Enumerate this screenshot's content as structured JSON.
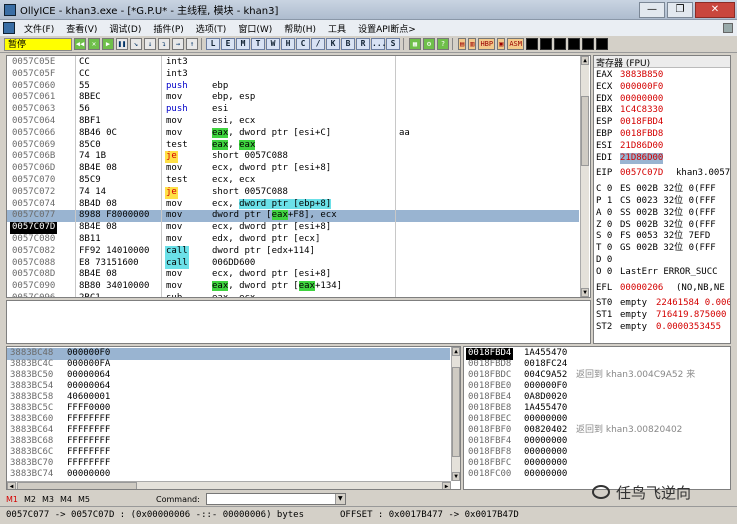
{
  "window": {
    "title": "OllyICE - khan3.exe - [*G.P.U* - 主线程, 模块 - khan3]",
    "min": "—",
    "max": "❐",
    "close": "✕"
  },
  "menu": [
    "文件(F)",
    "查看(V)",
    "调试(D)",
    "插件(P)",
    "选项(T)",
    "窗口(W)",
    "帮助(H)",
    "工具",
    "设置API断点>"
  ],
  "toolbar": {
    "status": "暂停",
    "buttons_a": [
      "◀◀",
      "✕",
      "▶",
      "❚❚",
      "↘",
      "↓",
      "↴",
      "→",
      "↑"
    ],
    "letters": [
      "L",
      "E",
      "M",
      "T",
      "W",
      "H",
      "C",
      "/",
      "K",
      "B",
      "R",
      "...",
      "S"
    ],
    "buttons_b": [
      "▦",
      "⚙",
      "?"
    ],
    "buttons_c": [
      "▤",
      "▥",
      "HBP",
      "▣",
      "ASM"
    ]
  },
  "disasm": {
    "rows": [
      {
        "addr": "0057C05E",
        "hex": "CC",
        "mn": "int3",
        "op": "",
        "cm": "",
        "mnstyle": "",
        "opparts": []
      },
      {
        "addr": "0057C05F",
        "hex": "CC",
        "mn": "int3",
        "op": "",
        "cm": "",
        "mnstyle": "",
        "opparts": []
      },
      {
        "addr": "0057C060",
        "hex": "55",
        "mn": "push",
        "op": "ebp",
        "cm": "",
        "mnstyle": "kw",
        "opparts": []
      },
      {
        "addr": "0057C061",
        "hex": "8BEC",
        "mn": "mov",
        "op": "ebp, esp",
        "cm": "",
        "mnstyle": "",
        "opparts": []
      },
      {
        "addr": "0057C063",
        "hex": "56",
        "mn": "push",
        "op": "esi",
        "cm": "",
        "mnstyle": "kw",
        "opparts": []
      },
      {
        "addr": "0057C064",
        "hex": "8BF1",
        "mn": "mov",
        "op": "esi, ecx",
        "cm": "",
        "mnstyle": "",
        "opparts": []
      },
      {
        "addr": "0057C066",
        "hex": "8B46 0C",
        "mn": "mov",
        "op": "",
        "cm": "aa",
        "mnstyle": "",
        "opparts": [
          {
            "t": "eax",
            "s": "hl-green"
          },
          {
            "t": ", dword ptr [esi+C]",
            "s": ""
          }
        ]
      },
      {
        "addr": "0057C069",
        "hex": "85C0",
        "mn": "test",
        "op": "",
        "cm": "",
        "mnstyle": "",
        "opparts": [
          {
            "t": "eax",
            "s": "hl-green"
          },
          {
            "t": ", ",
            "s": ""
          },
          {
            "t": "eax",
            "s": "hl-green"
          }
        ]
      },
      {
        "addr": "0057C06B",
        "hex": "74 1B",
        "mn": "je",
        "op": "short 0057C088",
        "cm": "",
        "mnstyle": "hl-yellow red",
        "opparts": []
      },
      {
        "addr": "0057C06D",
        "hex": "8B4E 08",
        "mn": "mov",
        "op": "ecx, dword ptr [esi+8]",
        "cm": "",
        "mnstyle": "",
        "opparts": []
      },
      {
        "addr": "0057C070",
        "hex": "85C9",
        "mn": "test",
        "op": "ecx, ecx",
        "cm": "",
        "mnstyle": "",
        "opparts": []
      },
      {
        "addr": "0057C072",
        "hex": "74 14",
        "mn": "je",
        "op": "short 0057C088",
        "cm": "",
        "mnstyle": "hl-yellow red",
        "opparts": []
      },
      {
        "addr": "0057C074",
        "hex": "8B4D 08",
        "mn": "mov",
        "op": "",
        "cm": "",
        "mnstyle": "",
        "opparts": [
          {
            "t": "ecx, ",
            "s": ""
          },
          {
            "t": "dword ptr [ebp+8]",
            "s": "hl-cyan"
          }
        ]
      },
      {
        "addr": "0057C077",
        "hex": "8988 F8000000",
        "mn": "mov",
        "op": "",
        "cm": "",
        "mnstyle": "",
        "opparts": [
          {
            "t": "dword ptr [",
            "s": ""
          },
          {
            "t": "eax",
            "s": "hl-green"
          },
          {
            "t": "+F8], ecx",
            "s": ""
          }
        ]
      },
      {
        "addr": "0057C07D",
        "hex": "8B4E 08",
        "mn": "mov",
        "op": "ecx, dword ptr [esi+8]",
        "cm": "",
        "mnstyle": "",
        "opparts": []
      },
      {
        "addr": "0057C080",
        "hex": "8B11",
        "mn": "mov",
        "op": "edx, dword ptr [ecx]",
        "cm": "",
        "mnstyle": "",
        "opparts": []
      },
      {
        "addr": "0057C082",
        "hex": "FF92 14010000",
        "mn": "call",
        "op": "dword ptr [edx+114]",
        "cm": "",
        "mnstyle": "hl-cyan",
        "opparts": []
      },
      {
        "addr": "0057C088",
        "hex": "E8 73151600",
        "mn": "call",
        "op": "006DD600",
        "cm": "",
        "mnstyle": "hl-cyan",
        "opparts": []
      },
      {
        "addr": "0057C08D",
        "hex": "8B4E 08",
        "mn": "mov",
        "op": "ecx, dword ptr [esi+8]",
        "cm": "",
        "mnstyle": "",
        "opparts": []
      },
      {
        "addr": "0057C090",
        "hex": "8B80 34010000",
        "mn": "mov",
        "op": "",
        "cm": "",
        "mnstyle": "",
        "opparts": [
          {
            "t": "eax",
            "s": "hl-green"
          },
          {
            "t": ", dword ptr [",
            "s": ""
          },
          {
            "t": "eax",
            "s": "hl-green"
          },
          {
            "t": "+134]",
            "s": ""
          }
        ]
      },
      {
        "addr": "0057C096",
        "hex": "2BC1",
        "mn": "sub",
        "op": "eax, ecx",
        "cm": "",
        "mnstyle": "",
        "opparts": []
      }
    ]
  },
  "registers": {
    "header": "寄存器 (FPU)",
    "regs": [
      {
        "n": "EAX",
        "v": "3883B850",
        "x": ""
      },
      {
        "n": "ECX",
        "v": "000000F0",
        "x": ""
      },
      {
        "n": "EDX",
        "v": "00000000",
        "x": ""
      },
      {
        "n": "EBX",
        "v": "1C4C8330",
        "x": ""
      },
      {
        "n": "ESP",
        "v": "0018FBD4",
        "x": ""
      },
      {
        "n": "EBP",
        "v": "0018FBD8",
        "x": ""
      },
      {
        "n": "ESI",
        "v": "21D86D00",
        "x": ""
      },
      {
        "n": "EDI",
        "v": "21D86D00",
        "x": ""
      }
    ],
    "eip": {
      "n": "EIP",
      "v": "0057C07D",
      "x": "khan3.0057"
    },
    "flags": [
      {
        "f": "C 0",
        "s": "ES 002B 32位 0(FFF"
      },
      {
        "f": "P 1",
        "s": "CS 0023 32位 0(FFF"
      },
      {
        "f": "A 0",
        "s": "SS 002B 32位 0(FFF"
      },
      {
        "f": "Z 0",
        "s": "DS 002B 32位 0(FFF"
      },
      {
        "f": "S 0",
        "s": "FS 0053 32位 7EFD"
      },
      {
        "f": "T 0",
        "s": "GS 002B 32位 0(FFF"
      },
      {
        "f": "D 0",
        "s": ""
      },
      {
        "f": "O 0",
        "s": "LastErr ERROR_SUCC"
      }
    ],
    "efl": {
      "n": "EFL",
      "v": "00000206",
      "x": "(NO,NB,NE"
    },
    "fpu": [
      {
        "n": "ST0",
        "e": "empty",
        "v": "22461584 0.000"
      },
      {
        "n": "ST1",
        "e": "empty",
        "v": "716419.875000"
      },
      {
        "n": "ST2",
        "e": "empty",
        "v": "0.0000353455"
      }
    ]
  },
  "dump": {
    "rows": [
      {
        "a": "3883BC48",
        "v": "000000F0"
      },
      {
        "a": "3883BC4C",
        "v": "000000FA"
      },
      {
        "a": "3883BC50",
        "v": "00000064"
      },
      {
        "a": "3883BC54",
        "v": "00000064"
      },
      {
        "a": "3883BC58",
        "v": "40600001"
      },
      {
        "a": "3883BC5C",
        "v": "FFFF0000"
      },
      {
        "a": "3883BC60",
        "v": "FFFFFFFF"
      },
      {
        "a": "3883BC64",
        "v": "FFFFFFFF"
      },
      {
        "a": "3883BC68",
        "v": "FFFFFFFF"
      },
      {
        "a": "3883BC6C",
        "v": "FFFFFFFF"
      },
      {
        "a": "3883BC70",
        "v": "FFFFFFFF"
      },
      {
        "a": "3883BC74",
        "v": "00000000"
      }
    ]
  },
  "stack": {
    "rows": [
      {
        "a": "0018FBD4",
        "v": "1A455470",
        "c": ""
      },
      {
        "a": "0018FBD8",
        "v": "0018FC24",
        "c": ""
      },
      {
        "a": "0018FBDC",
        "v": "004C9A52",
        "c": "返回到 khan3.004C9A52 来"
      },
      {
        "a": "0018FBE0",
        "v": "000000F0",
        "c": ""
      },
      {
        "a": "0018FBE4",
        "v": "0A8D0020",
        "c": ""
      },
      {
        "a": "0018FBE8",
        "v": "1A455470",
        "c": ""
      },
      {
        "a": "0018FBEC",
        "v": "00000000",
        "c": ""
      },
      {
        "a": "0018FBF0",
        "v": "00820402",
        "c": "返回到 khan3.00820402"
      },
      {
        "a": "0018FBF4",
        "v": "00000000",
        "c": ""
      },
      {
        "a": "0018FBF8",
        "v": "00000000",
        "c": ""
      },
      {
        "a": "0018FBFC",
        "v": "00000000",
        "c": ""
      },
      {
        "a": "0018FC00",
        "v": "00000000",
        "c": ""
      }
    ]
  },
  "cmd": {
    "tabs": [
      "M1",
      "M2",
      "M3",
      "M4",
      "M5"
    ],
    "label": "Command:"
  },
  "status": {
    "left": "0057C077 -> 0057C07D : (0x00000006 -::- 00000006) bytes",
    "right": "OFFSET : 0x0017B477 -> 0x0017B47D"
  },
  "watermark": "任鸟飞逆向",
  "colors": {
    "accent": "#99b4d1",
    "register_value": "#d40000",
    "status_badge": "#ffff00"
  }
}
